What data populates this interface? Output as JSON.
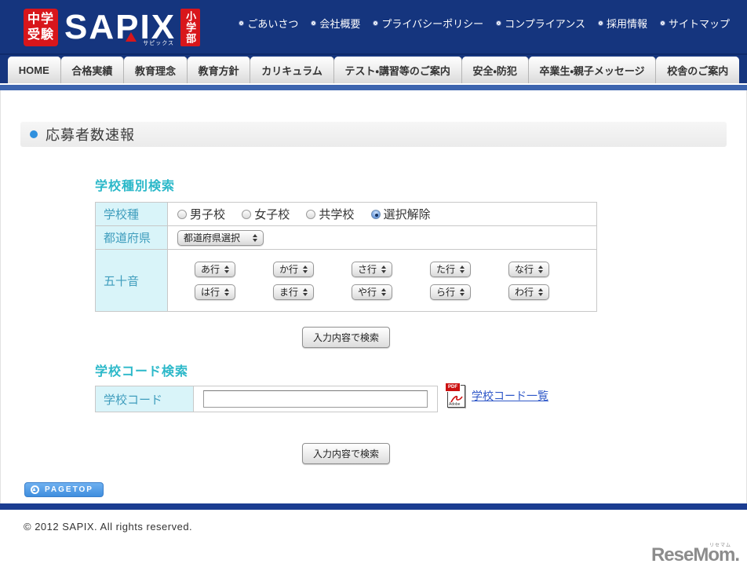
{
  "colors": {
    "header_bg": "#15357E",
    "nav_accent_blue": "#3C64AE",
    "footer_accent_blue": "#1B3D91",
    "brand_red": "#D8161B",
    "section_heading_teal": "#2BB8C9",
    "table_label_bg": "#D9F4F9",
    "table_label_text": "#3F9DBD",
    "link_blue": "#2E57C8",
    "pagetop_blue": "#4F9BE8",
    "title_icon_blue": "#2F90DE"
  },
  "header": {
    "logo": {
      "badge_line1": "中学",
      "badge_line2": "受験",
      "brand": "SAPIX",
      "brand_ruby": "サピックス",
      "division": "小学部"
    },
    "links": [
      {
        "label": "ごあいさつ"
      },
      {
        "label": "会社概要"
      },
      {
        "label": "プライバシーポリシー"
      },
      {
        "label": "コンプライアンス"
      },
      {
        "label": "採用情報"
      },
      {
        "label": "サイトマップ"
      }
    ]
  },
  "nav": {
    "tabs": [
      {
        "label": "HOME"
      },
      {
        "label": "合格実績"
      },
      {
        "label": "教育理念"
      },
      {
        "label": "教育方針"
      },
      {
        "label": "カリキュラム"
      },
      {
        "label": "テスト・講習等のご案内"
      },
      {
        "label": "安全・防犯"
      },
      {
        "label": "卒業生・親子メッセージ"
      },
      {
        "label": "校舎のご案内"
      }
    ]
  },
  "page": {
    "title": "応募者数速報"
  },
  "school_type_search": {
    "heading": "学校種別検索",
    "school_type_row": {
      "label": "学校種",
      "options": [
        {
          "label": "男子校",
          "selected": false
        },
        {
          "label": "女子校",
          "selected": false
        },
        {
          "label": "共学校",
          "selected": false
        },
        {
          "label": "選択解除",
          "selected": true
        }
      ]
    },
    "prefecture_row": {
      "label": "都道府県",
      "select_value": "都道府県選択"
    },
    "syllabary_row": {
      "label": "五十音",
      "row1": [
        {
          "value": "あ行"
        },
        {
          "value": "か行"
        },
        {
          "value": "さ行"
        },
        {
          "value": "た行"
        },
        {
          "value": "な行"
        }
      ],
      "row2": [
        {
          "value": "は行"
        },
        {
          "value": "ま行"
        },
        {
          "value": "や行"
        },
        {
          "value": "ら行"
        },
        {
          "value": "わ行"
        }
      ]
    },
    "search_button_label": "入力内容で検索"
  },
  "school_code_search": {
    "heading": "学校コード検索",
    "row_label": "学校コード",
    "input_value": "",
    "pdf_icon": {
      "banner": "PDF",
      "caption": "Adobe"
    },
    "pdf_link_label": "学校コード一覧",
    "search_button_label": "入力内容で検索"
  },
  "pagetop_label": "PAGETOP",
  "footer": {
    "copyright": "© 2012 SAPIX. All rights reserved."
  },
  "watermark": {
    "brand": "ReseMom.",
    "ruby": "リセマム"
  }
}
